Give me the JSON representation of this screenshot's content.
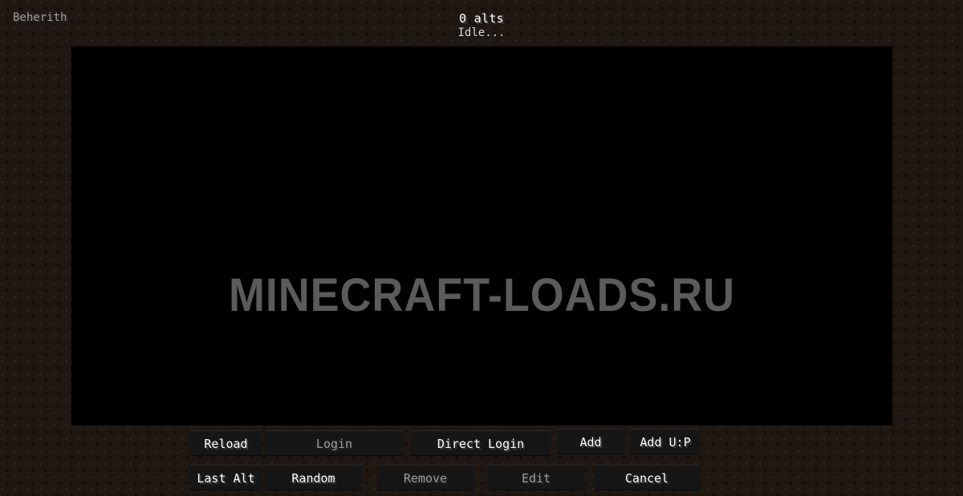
{
  "header": {
    "account_name": "Beherith",
    "alts_count": "0 alts",
    "status": "Idle..."
  },
  "list": {
    "watermark": "MINECRAFT-LOADS.RU"
  },
  "buttons_row1": {
    "reload": "Reload",
    "login": "Login",
    "direct_login": "Direct Login",
    "add": "Add",
    "add_up": "Add U:P"
  },
  "buttons_row2": {
    "last_alt": "Last Alt",
    "random": "Random",
    "remove": "Remove",
    "edit": "Edit",
    "cancel": "Cancel"
  },
  "colors": {
    "background": "#1e1712",
    "list_background": "#000000",
    "button_background": "#161616",
    "button_text": "#ffffff",
    "button_disabled_text": "#9c9c9c"
  }
}
